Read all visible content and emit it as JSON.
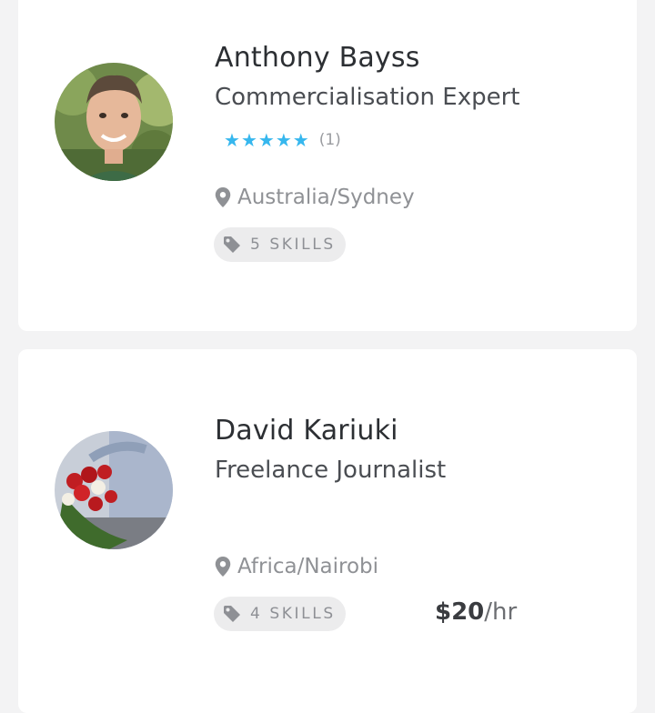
{
  "freelancers": [
    {
      "name": "Anthony Bayss",
      "title": "Commercialisation Expert",
      "rating": {
        "stars": 5,
        "count_label": "(1)"
      },
      "location": "Australia/Sydney",
      "skills_label": "5 SKILLS"
    },
    {
      "name": "David Kariuki",
      "title": "Freelance Journalist",
      "location": "Africa/Nairobi",
      "skills_label": "4 SKILLS",
      "price": {
        "amount": "$20",
        "unit": "/hr"
      }
    }
  ],
  "icons": {
    "star": "star-icon",
    "location": "map-pin-icon",
    "skills": "tag-icon"
  },
  "colors": {
    "star": "#36b7ee",
    "background": "#f3f3f4",
    "card": "#ffffff"
  }
}
